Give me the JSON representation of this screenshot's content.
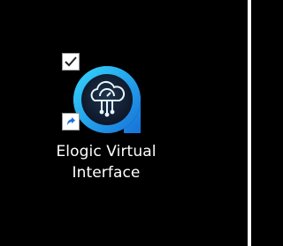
{
  "desktop": {
    "background_color": "#000000",
    "shortcut": {
      "line1": "Elogic Virtual",
      "line2": "Interface",
      "selected": true,
      "icon": "elogic-cloud-app-icon",
      "overlay_icon": "shortcut-arrow-icon",
      "checkbox_icon": "selection-checkbox-icon",
      "accent_colors": [
        "#1aa6f0",
        "#38e0ff",
        "#1f3a5a"
      ]
    }
  }
}
